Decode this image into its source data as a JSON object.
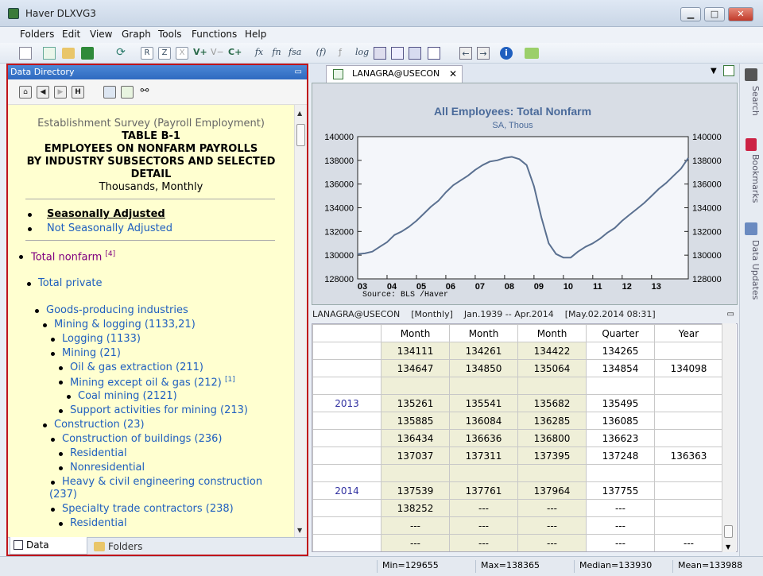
{
  "window": {
    "title": "Haver DLXVG3",
    "minimize": "▁",
    "maximize": "□",
    "close": "✕"
  },
  "menu": [
    "Folders",
    "Edit",
    "View",
    "Graph",
    "Tools",
    "Functions",
    "Help"
  ],
  "toolbar": {
    "letters": [
      "R",
      "Z",
      "X"
    ],
    "vplus": "V+",
    "vminus": "V−",
    "cplus": "C+",
    "fx": "fx",
    "fn": "fn",
    "fsa": "fsa",
    "f": "(f)",
    "log": "log",
    "info": "i"
  },
  "data_directory": {
    "header": "Data Directory",
    "survey_title": "Establishment Survey (Payroll Employment)",
    "table_id": "TABLE B-1",
    "heading_line1": "EMPLOYEES ON NONFARM PAYROLLS",
    "heading_line2": "BY INDUSTRY SUBSECTORS AND SELECTED",
    "heading_line3": "DETAIL",
    "units": "Thousands, Monthly",
    "adjust_options": [
      "Seasonally Adjusted",
      "Not Seasonally Adjusted"
    ],
    "tree": [
      {
        "label": "Total nonfarm",
        "sup": "[4]"
      },
      {
        "label": "Total private"
      },
      {
        "label": "Goods-producing industries"
      },
      {
        "label": "Mining & logging (1133,21)"
      },
      {
        "label": "Logging (1133)"
      },
      {
        "label": "Mining (21)"
      },
      {
        "label": "Oil & gas extraction (211)"
      },
      {
        "label": "Mining except oil & gas (212)",
        "sup": "[1]"
      },
      {
        "label": "Coal mining (2121)"
      },
      {
        "label": "Support activities for mining (213)"
      },
      {
        "label": "Construction (23)"
      },
      {
        "label": "Construction of buildings (236)"
      },
      {
        "label": "Residential"
      },
      {
        "label": "Nonresidential"
      },
      {
        "label": "Heavy & civil engineering construction"
      },
      {
        "label": "(237)"
      },
      {
        "label": "Specialty trade contractors (238)"
      },
      {
        "label": "Residential"
      }
    ],
    "tabs": {
      "data_directory": "Data Directory",
      "folders": "Folders"
    }
  },
  "graph": {
    "tab_label": "LANAGRA@USECON",
    "side_tabs": [
      "Search",
      "Bookmarks",
      "Data Updates"
    ]
  },
  "chart_data": {
    "type": "line",
    "title": "All Employees: Total Nonfarm",
    "subtitle": "SA, Thous",
    "source": "Source:  BLS /Haver",
    "x_tick_labels": [
      "03",
      "04",
      "05",
      "06",
      "07",
      "08",
      "09",
      "10",
      "11",
      "12",
      "13"
    ],
    "xlim": [
      2003.0,
      2014.25
    ],
    "ylim": [
      128000,
      140000
    ],
    "y_ticks": [
      128000,
      130000,
      132000,
      134000,
      136000,
      138000,
      140000
    ],
    "dual_y_axis": true,
    "grid": false,
    "series": [
      {
        "x": [
          2003.0,
          2003.25,
          2003.5,
          2003.75,
          2004.0,
          2004.25,
          2004.5,
          2004.75,
          2005.0,
          2005.25,
          2005.5,
          2005.75,
          2006.0,
          2006.25,
          2006.5,
          2006.75,
          2007.0,
          2007.25,
          2007.5,
          2007.75,
          2008.0,
          2008.25,
          2008.5,
          2008.75,
          2009.0,
          2009.25,
          2009.5,
          2009.75,
          2010.0,
          2010.25,
          2010.5,
          2010.75,
          2011.0,
          2011.25,
          2011.5,
          2011.75,
          2012.0,
          2012.25,
          2012.5,
          2012.75,
          2013.0,
          2013.25,
          2013.5,
          2013.75,
          2014.0,
          2014.25
        ],
        "values": [
          130100,
          130150,
          130300,
          130700,
          131100,
          131700,
          132000,
          132400,
          132900,
          133500,
          134100,
          134600,
          135300,
          135900,
          136300,
          136700,
          137200,
          137600,
          137900,
          138000,
          138200,
          138300,
          138100,
          137600,
          135800,
          133200,
          131000,
          130100,
          129800,
          129800,
          130300,
          130700,
          131000,
          131400,
          131900,
          132300,
          132900,
          133400,
          133900,
          134400,
          135000,
          135600,
          136100,
          136700,
          137300,
          138200
        ]
      }
    ]
  },
  "data_table": {
    "header_bar": "LANAGRA@USECON    [Monthly]    Jan.1939 -- Apr.2014    [May.02.2014 08:31]",
    "columns": [
      "Month",
      "Month",
      "Month",
      "Quarter",
      "Year"
    ],
    "rows": [
      [
        "",
        "134111",
        "134261",
        "134422",
        "134265",
        ""
      ],
      [
        "",
        "134647",
        "134850",
        "135064",
        "134854",
        "134098"
      ],
      [
        "",
        "",
        "",
        "",
        "",
        ""
      ],
      [
        "2013",
        "135261",
        "135541",
        "135682",
        "135495",
        ""
      ],
      [
        "",
        "135885",
        "136084",
        "136285",
        "136085",
        ""
      ],
      [
        "",
        "136434",
        "136636",
        "136800",
        "136623",
        ""
      ],
      [
        "",
        "137037",
        "137311",
        "137395",
        "137248",
        "136363"
      ],
      [
        "",
        "",
        "",
        "",
        "",
        ""
      ],
      [
        "2014",
        "137539",
        "137761",
        "137964",
        "137755",
        ""
      ],
      [
        "",
        "138252",
        "---",
        "---",
        "---",
        ""
      ],
      [
        "",
        "---",
        "---",
        "---",
        "---",
        ""
      ],
      [
        "",
        "---",
        "---",
        "---",
        "---",
        "---"
      ]
    ]
  },
  "status": {
    "min": "Min=129655",
    "max": "Max=138365",
    "median": "Median=133930",
    "mean": "Mean=133988"
  }
}
